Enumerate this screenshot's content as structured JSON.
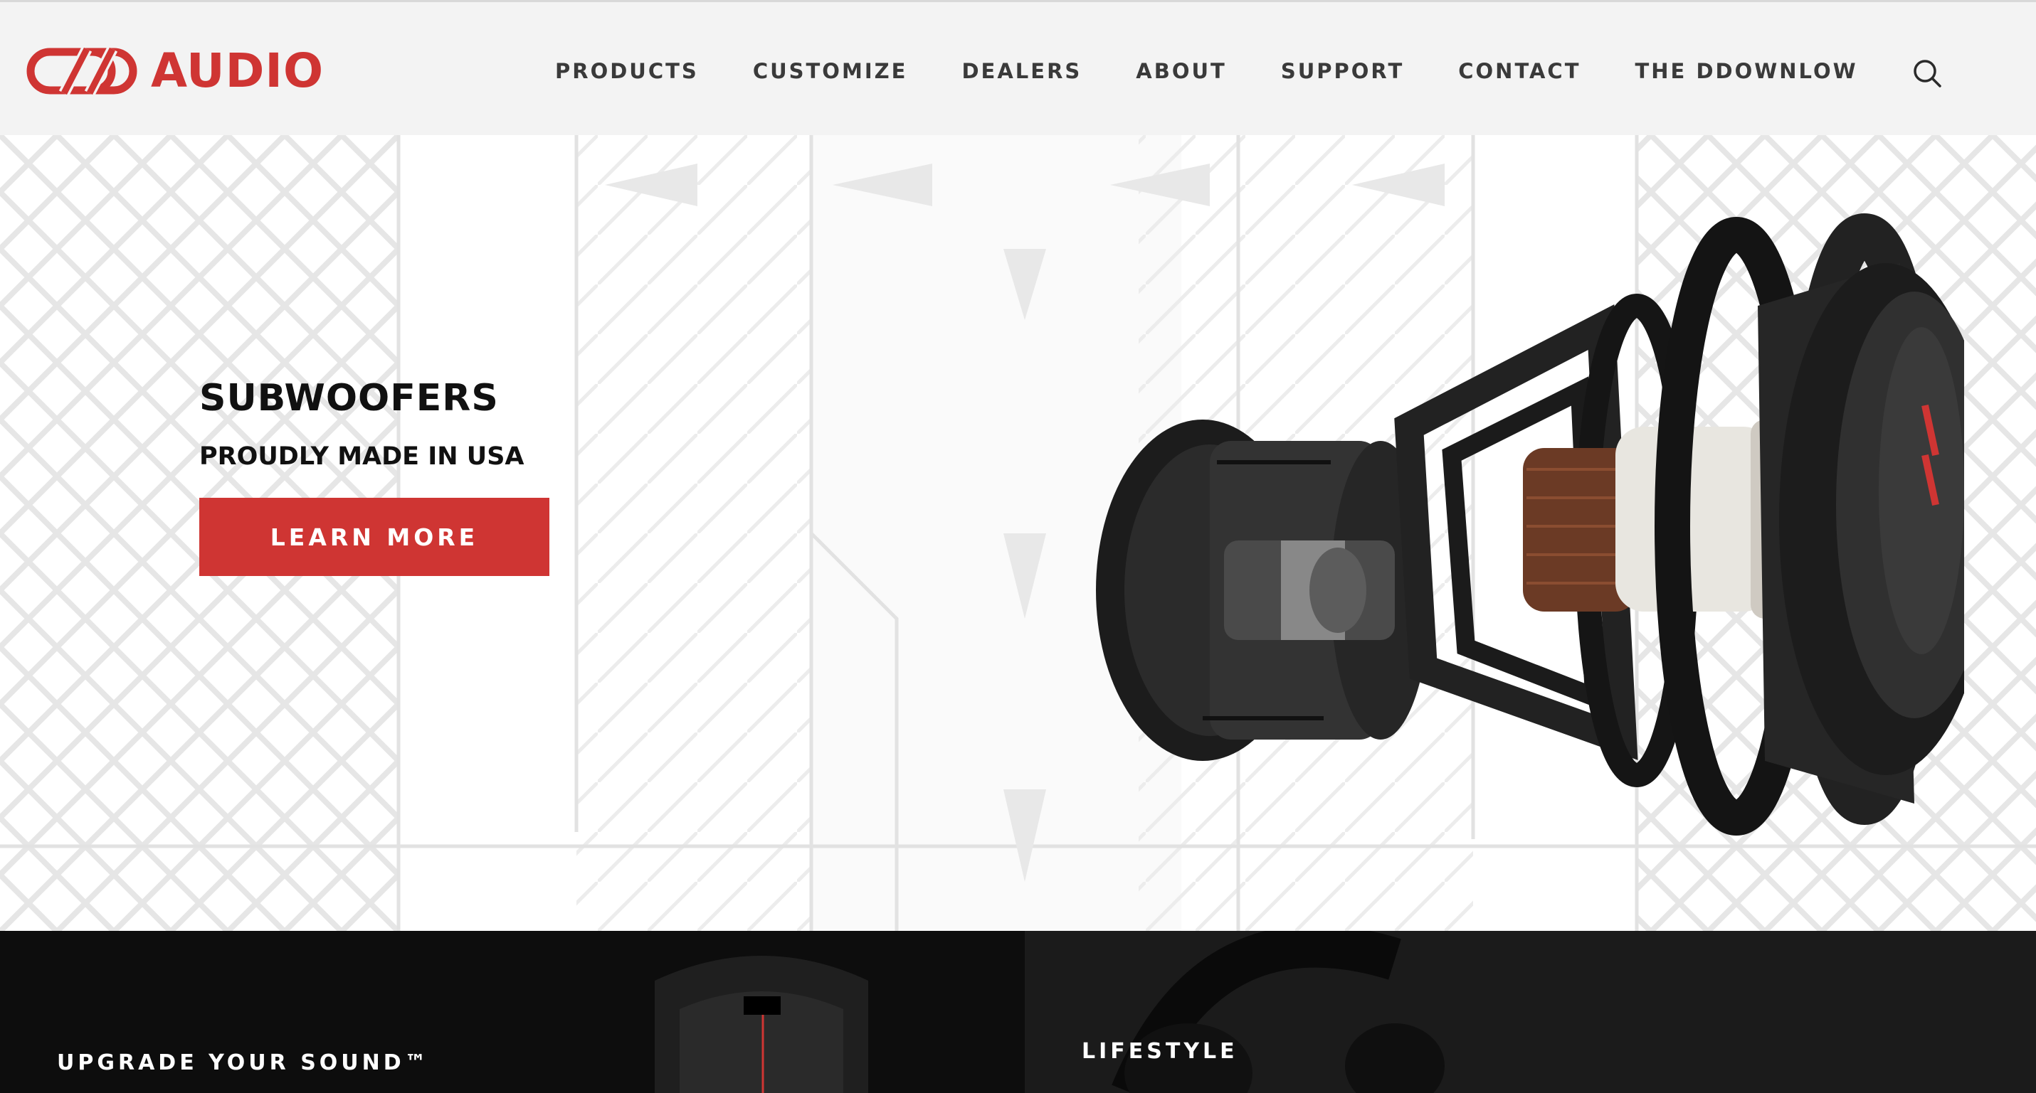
{
  "header": {
    "logo_text": "AUDIO",
    "nav": [
      {
        "label": "PRODUCTS"
      },
      {
        "label": "CUSTOMIZE"
      },
      {
        "label": "DEALERS"
      },
      {
        "label": "ABOUT"
      },
      {
        "label": "SUPPORT"
      },
      {
        "label": "CONTACT"
      },
      {
        "label": "THE DDOWNLOW"
      }
    ],
    "search_icon": "search-icon"
  },
  "hero": {
    "title": "SUBWOOFERS",
    "subtitle": "PROUDLY MADE IN USA",
    "cta_label": "LEARN MORE",
    "product_icon": "subwoofer-exploded-view-image"
  },
  "promos": {
    "left_label": "UPGRADE YOUR SOUND™",
    "right_label": "LIFESTYLE"
  },
  "colors": {
    "brand_red": "#cf3533",
    "header_bg": "#f3f3f3",
    "nav_text": "#3a3a3a",
    "dark_tile": "#0d0d0d"
  }
}
